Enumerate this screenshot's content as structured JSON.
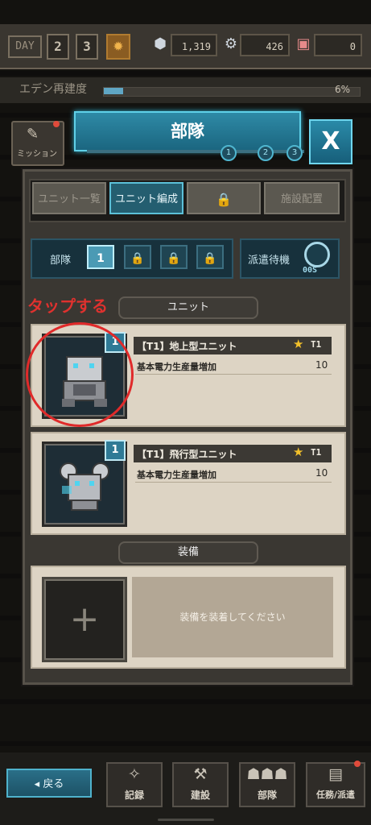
{
  "topbar": {
    "day_label": "DAY",
    "day_digits": [
      "2",
      "3"
    ],
    "resources": [
      {
        "icon": "cube-icon",
        "value": "1,319"
      },
      {
        "icon": "gear-part-icon",
        "value": "426"
      },
      {
        "icon": "battery-icon",
        "value": "0"
      }
    ]
  },
  "eden": {
    "label": "エデン再建度",
    "percent_text": "6%",
    "progress": 0.06
  },
  "mission": {
    "label": "ミッション"
  },
  "header": {
    "title": "部隊",
    "close_label": "X",
    "page_dots": [
      "1",
      "2",
      "3"
    ]
  },
  "tabs": [
    {
      "label": "ユニット一覧",
      "state": "inactive"
    },
    {
      "label": "ユニット編成",
      "state": "active"
    },
    {
      "label": "🔒",
      "state": "locked"
    },
    {
      "label": "施設配置",
      "state": "inactive"
    }
  ],
  "troop": {
    "label": "部隊",
    "slots": [
      "1",
      "🔒",
      "🔒",
      "🔒"
    ]
  },
  "standby": {
    "label": "派遣待機",
    "sub": "00S"
  },
  "annotation": "タップする",
  "units_section": {
    "header": "ユニット"
  },
  "units": [
    {
      "badge": "1",
      "name": "【T1】地上型ユニット",
      "tier": "T1",
      "stat_label": "基本電力生産量増加",
      "stat_value": "10"
    },
    {
      "badge": "1",
      "name": "【T1】飛行型ユニット",
      "tier": "T1",
      "stat_label": "基本電力生産量増加",
      "stat_value": "10"
    }
  ],
  "equip_section": {
    "header": "装備",
    "slot_label": "+",
    "message": "装備を装着してください"
  },
  "bottom_nav": {
    "back_label": "◂ 戻る",
    "items": [
      {
        "icon": "compass-star-icon",
        "label": "記録"
      },
      {
        "icon": "hammer-icon",
        "label": "建設"
      },
      {
        "icon": "group-icon",
        "label": "部隊"
      },
      {
        "icon": "document-icon",
        "label": "任務/派遣"
      }
    ]
  },
  "colors": {
    "accent": "#2e8aa6",
    "annotation": "#e0312e",
    "star": "#f2c02a"
  }
}
